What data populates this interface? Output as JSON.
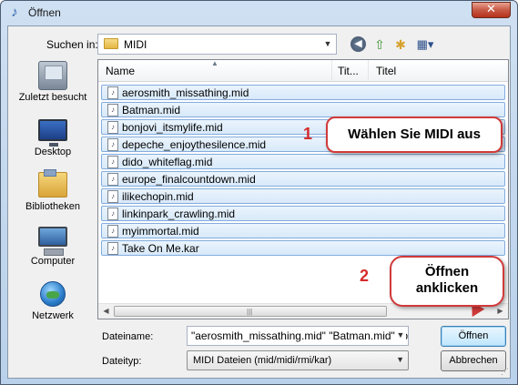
{
  "window": {
    "title": "Öffnen",
    "close_label": "✕"
  },
  "lookin": {
    "label": "Suchen in:",
    "value": "MIDI"
  },
  "toolbar": {
    "back_icon": "back-arrow-icon",
    "up_icon": "up-folder-icon",
    "new_folder_icon": "new-folder-icon",
    "views_icon": "views-menu-icon"
  },
  "places": [
    {
      "label": "Zuletzt besucht",
      "icon": "recent-places-icon"
    },
    {
      "label": "Desktop",
      "icon": "desktop-icon"
    },
    {
      "label": "Bibliotheken",
      "icon": "libraries-icon"
    },
    {
      "label": "Computer",
      "icon": "computer-icon"
    },
    {
      "label": "Netzwerk",
      "icon": "network-icon"
    }
  ],
  "filelist": {
    "columns": [
      "Name",
      "Tit...",
      "Titel"
    ],
    "files": [
      "aerosmith_missathing.mid",
      "Batman.mid",
      "bonjovi_itsmylife.mid",
      "depeche_enjoythesilence.mid",
      "dido_whiteflag.mid",
      "europe_finalcountdown.mid",
      "ilikechopin.mid",
      "linkinpark_crawling.mid",
      "myimmortal.mid",
      "Take On Me.kar"
    ]
  },
  "form": {
    "filename_label": "Dateiname:",
    "filename_value": "\"aerosmith_missathing.mid\" \"Batman.mid\" \"bon",
    "filetype_label": "Dateityp:",
    "filetype_value": "MIDI Dateien (mid/midi/rmi/kar)"
  },
  "buttons": {
    "open": "Öffnen",
    "cancel": "Abbrechen"
  },
  "annotations": {
    "step1_number": "1",
    "step1_text": "Wählen Sie MIDI aus",
    "step2_number": "2",
    "step2_line1": "Öffnen",
    "step2_line2": "anklicken"
  },
  "colors": {
    "callout_border": "#d03a3a",
    "selection": "#d8e9f9"
  }
}
